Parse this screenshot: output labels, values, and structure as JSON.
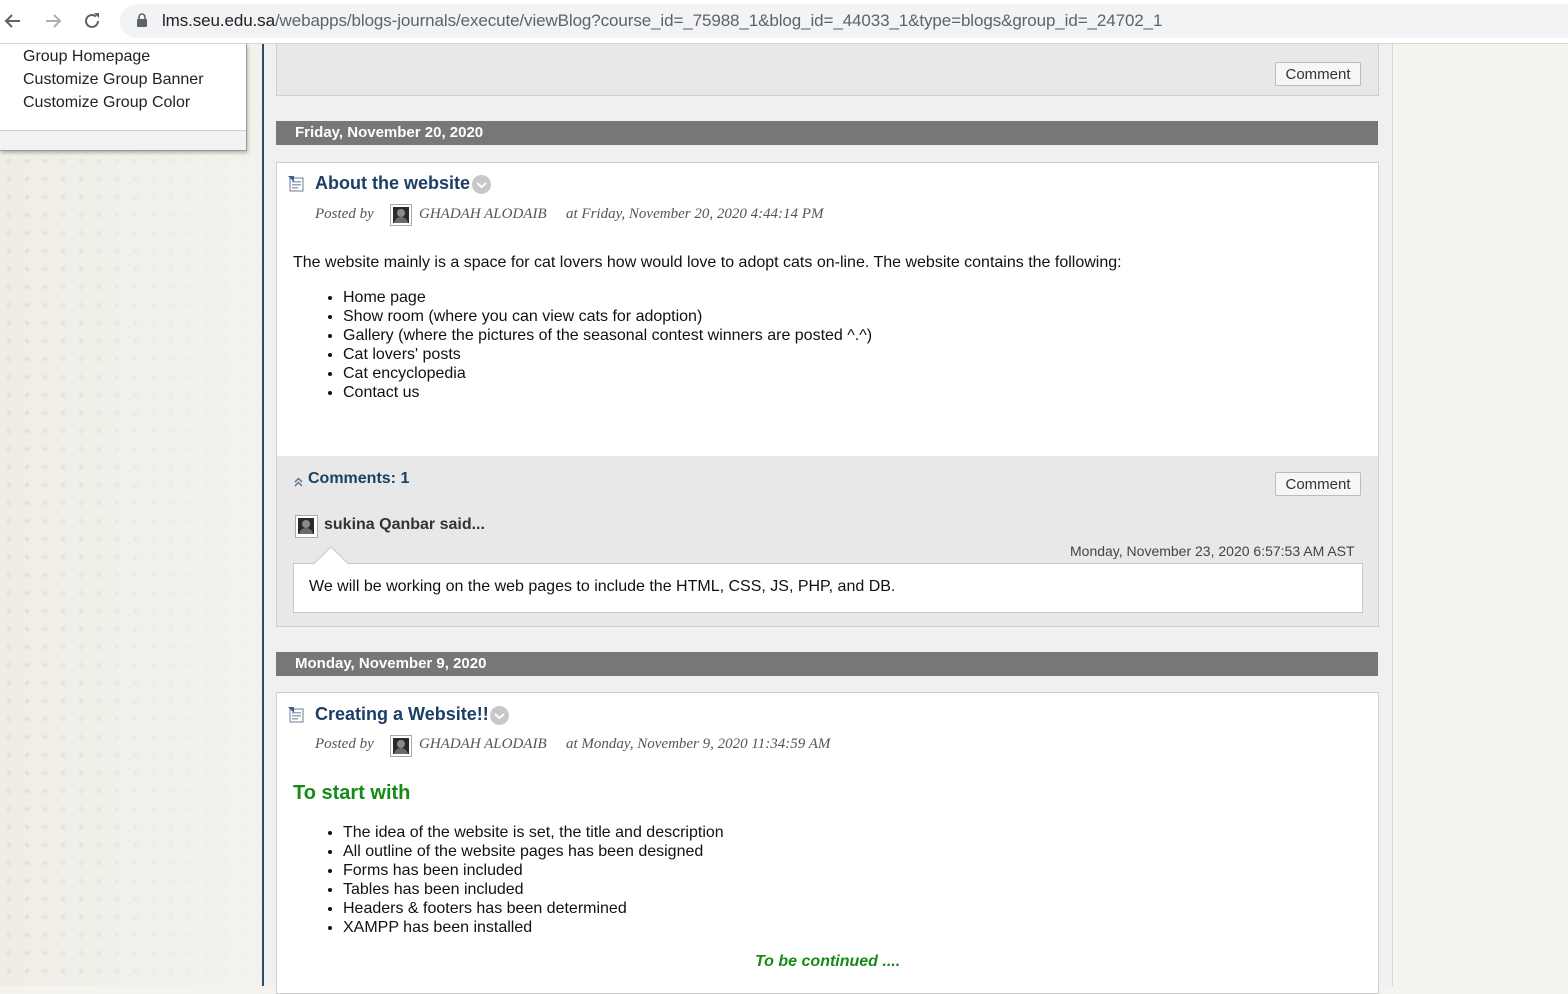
{
  "browser": {
    "url_host": "lms.seu.edu.sa",
    "url_path": "/webapps/blogs-journals/execute/viewBlog?course_id=_75988_1&blog_id=_44033_1&type=blogs&group_id=_24702_1"
  },
  "sidebar": {
    "items": [
      {
        "label": "Group Homepage"
      },
      {
        "label": "Customize Group Banner"
      },
      {
        "label": "Customize Group Color"
      }
    ]
  },
  "top_card": {
    "comment_button": "Comment"
  },
  "posts": [
    {
      "date": "Friday, November 20, 2020",
      "title": "About the website",
      "posted_by_label": "Posted by",
      "author": "GHADAH ALODAIB",
      "posted_at": "at Friday, November 20, 2020 4:44:14 PM",
      "body_intro": "The website mainly is a space for cat lovers how would love to adopt cats on-line. The website contains the following:",
      "list": [
        "Home page",
        "Show room (where you can view cats for adoption)",
        "Gallery (where the pictures of the seasonal contest winners are posted ^.^)",
        "Cat lovers' posts",
        "Cat encyclopedia",
        "Contact us"
      ],
      "comments_label": "Comments: 1",
      "comment_button": "Comment",
      "comments": [
        {
          "author_said": "sukina Qanbar said...",
          "timestamp": "Monday, November 23, 2020 6:57:53 AM AST",
          "text": "We will be working on the web pages to include the HTML, CSS, JS, PHP, and DB."
        }
      ]
    },
    {
      "date": "Monday, November 9, 2020",
      "title": "Creating a Website!!",
      "posted_by_label": "Posted by",
      "author": "GHADAH ALODAIB",
      "posted_at": "at Monday, November 9, 2020 11:34:59 AM",
      "heading": "To start with",
      "list": [
        "The idea of the website is set, the title and description",
        "All outline of the website pages has been designed",
        "Forms has been included",
        "Tables has been included",
        "Headers & footers has been determined",
        "XAMPP has been installed"
      ],
      "footer_note": "To be continued ...."
    }
  ],
  "colors": {
    "title_blue": "#1b3f66",
    "heading_green": "#178a17",
    "date_bar": "#777777"
  }
}
